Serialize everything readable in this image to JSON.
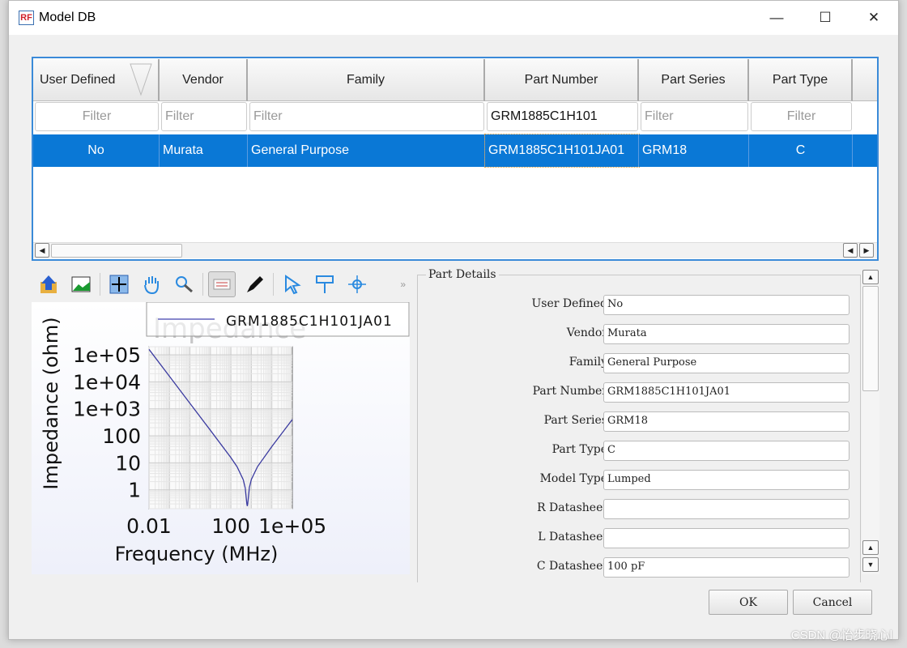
{
  "window": {
    "title": "Model DB",
    "logo": "RF"
  },
  "table": {
    "columns": [
      {
        "header": "User Defined",
        "filter": "",
        "placeholder": "Filter",
        "cell": "No"
      },
      {
        "header": "Vendor",
        "filter": "",
        "placeholder": "Filter",
        "cell": "Murata"
      },
      {
        "header": "Family",
        "filter": "",
        "placeholder": "Filter",
        "cell": "General Purpose"
      },
      {
        "header": "Part Number",
        "filter": "GRM1885C1H101",
        "placeholder": "Filter",
        "cell": "GRM1885C1H101JA01"
      },
      {
        "header": "Part Series",
        "filter": "",
        "placeholder": "Filter",
        "cell": "GRM18"
      },
      {
        "header": "Part Type",
        "filter": "",
        "placeholder": "Filter",
        "cell": "C"
      }
    ],
    "selection_color": "#0a78d6"
  },
  "toolbar": {
    "icons": [
      "export-icon",
      "image-icon",
      "fit-grid-icon",
      "pan-hand-icon",
      "zoom-icon",
      "legend-icon",
      "pen-icon",
      "select-arrow-icon",
      "marker-icon",
      "crosshair-icon"
    ],
    "more": "»"
  },
  "chart_data": {
    "type": "line",
    "title": "Impedance",
    "xlabel": "Frequency (MHz)",
    "ylabel": "Impedance (ohm)",
    "xscale": "log",
    "yscale": "log",
    "xlim": [
      0.01,
      100000
    ],
    "ylim": [
      0.2,
      200000
    ],
    "xticks": [
      "0.01",
      "100",
      "1e+05"
    ],
    "yticks": [
      "1e+05",
      "1e+04",
      "1e+03",
      "100",
      "10",
      "1"
    ],
    "grid": true,
    "legend": "top-right",
    "series": [
      {
        "name": "GRM1885C1H101JA01",
        "color": "#3a3aa0",
        "x": [
          0.01,
          0.1,
          1,
          10,
          100,
          200,
          400,
          500,
          600,
          630,
          660,
          800,
          1000,
          2000,
          10000,
          100000
        ],
        "y": [
          159155,
          15915,
          1592,
          159.1,
          15.5,
          7.15,
          2.37,
          1.17,
          0.3,
          0.25,
          0.3,
          1.23,
          2.43,
          7.25,
          40.1,
          402
        ]
      }
    ]
  },
  "details": {
    "title": "Part Details",
    "fields": [
      {
        "label": "User Defined",
        "value": "No"
      },
      {
        "label": "Vendor",
        "value": "Murata"
      },
      {
        "label": "Family",
        "value": "General Purpose"
      },
      {
        "label": "Part Number",
        "value": "GRM1885C1H101JA01"
      },
      {
        "label": "Part Series",
        "value": "GRM18"
      },
      {
        "label": "Part Type",
        "value": "C"
      },
      {
        "label": "Model Type",
        "value": "Lumped"
      },
      {
        "label": "R Datasheet",
        "value": ""
      },
      {
        "label": "L Datasheet",
        "value": ""
      },
      {
        "label": "C Datasheet",
        "value": "100 pF"
      }
    ]
  },
  "buttons": {
    "ok": "OK",
    "cancel": "Cancel"
  },
  "watermark": "CSDN @怡步晓心l"
}
